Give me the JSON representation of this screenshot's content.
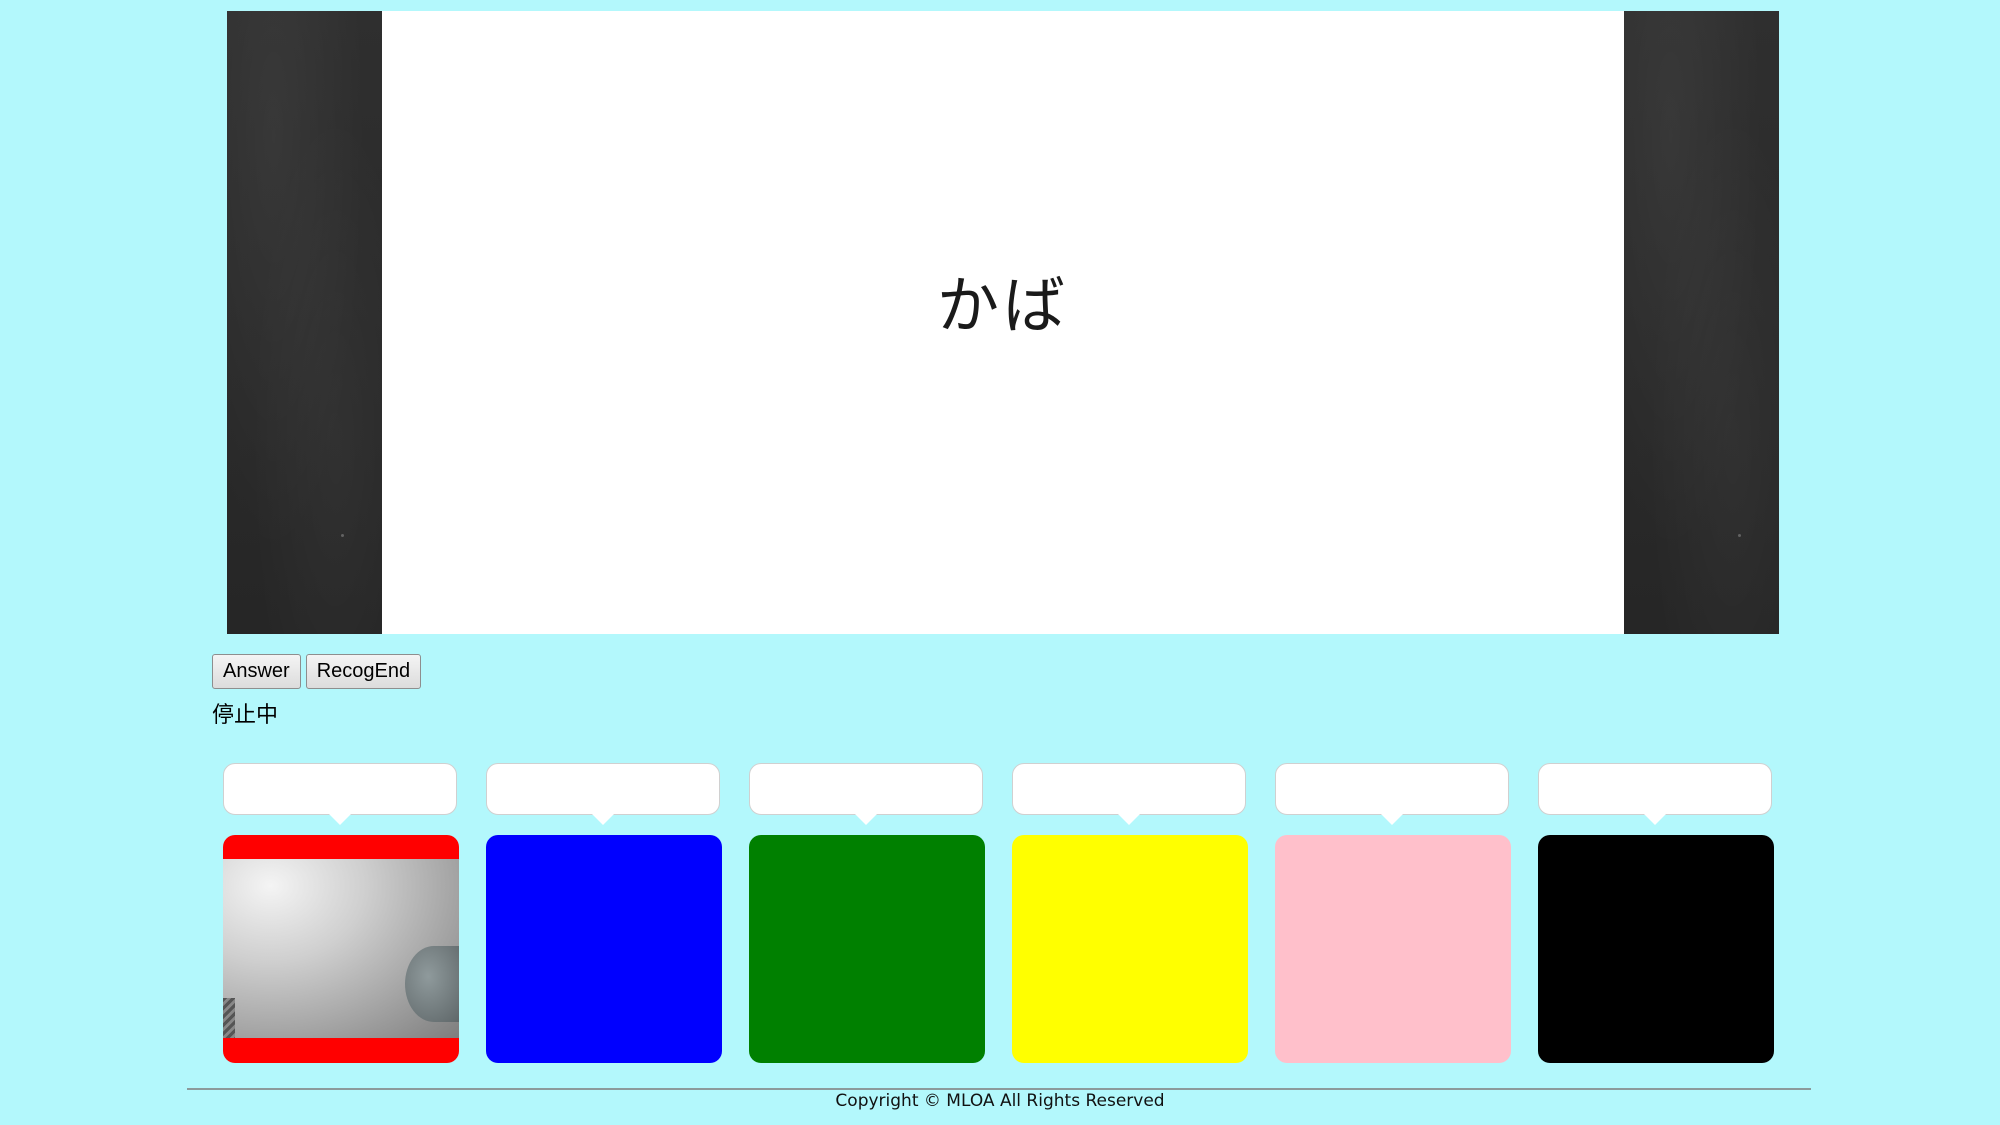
{
  "board": {
    "word": "かば"
  },
  "controls": {
    "answer_label": "Answer",
    "recog_end_label": "RecogEnd"
  },
  "status": {
    "text": "停止中"
  },
  "slots": [
    {
      "color": "#ff0000",
      "selected": true,
      "shows_camera": true
    },
    {
      "color": "#0000ff"
    },
    {
      "color": "#008000"
    },
    {
      "color": "#ffff00"
    },
    {
      "color": "#ffc0cb"
    },
    {
      "color": "#000000"
    }
  ],
  "colors": {
    "background": "#b3f8fc",
    "board_frame": "#2c2c2c",
    "card": "#ffffff"
  },
  "footer": {
    "copyright": "Copyright © MLOA All Rights Reserved"
  }
}
